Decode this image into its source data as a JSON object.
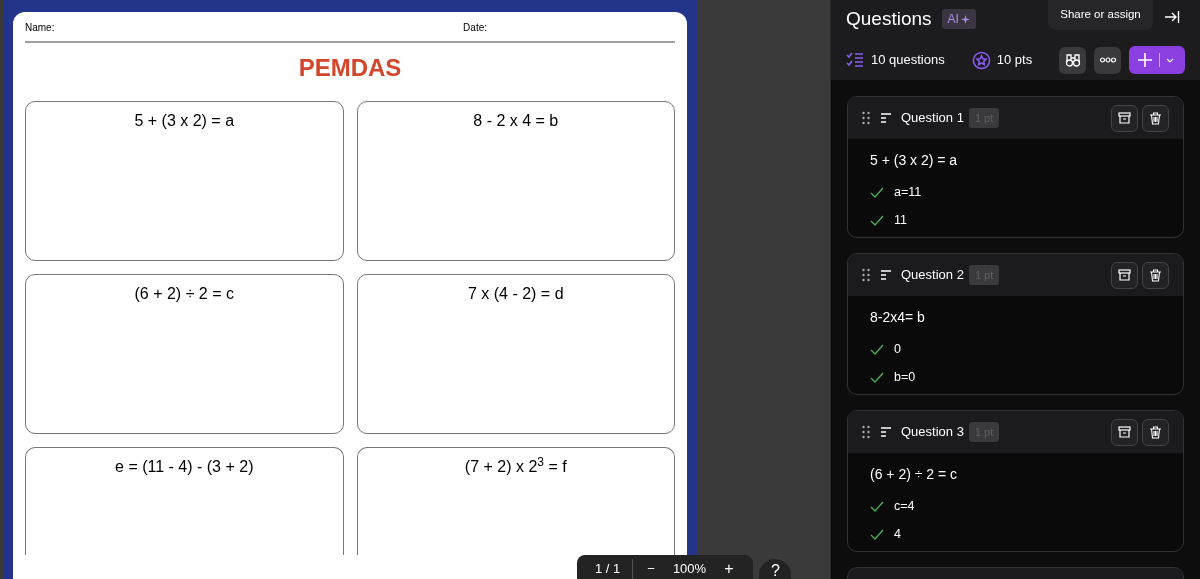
{
  "worksheet": {
    "name_label": "Name:",
    "date_label": "Date:",
    "title": "PEMDAS",
    "problems": [
      "5 + (3 x 2) = a",
      "8 - 2 x 4 = b",
      "(6 + 2) ÷ 2 = c",
      "7 x (4 - 2) = d",
      "e = (11 - 4) - (3 + 2)",
      "(7 + 2) x 2$^{3}$ = f"
    ]
  },
  "viewer_toolbar": {
    "page": "1 / 1",
    "zoom_out": "−",
    "zoom": "100%",
    "zoom_in": "+",
    "help": "?"
  },
  "panel": {
    "title": "Questions",
    "ai_badge": "AI",
    "tooltip": "Share or assign",
    "question_count": "10 questions",
    "points": "10 pts",
    "questions": [
      {
        "title": "Question 1",
        "points": "1 pt",
        "prompt": "5 + (3 x 2) = a",
        "answers": [
          "a=11",
          "11"
        ]
      },
      {
        "title": "Question 2",
        "points": "1 pt",
        "prompt": "8-2x4= b",
        "answers": [
          "0",
          "b=0"
        ]
      },
      {
        "title": "Question 3",
        "points": "1 pt",
        "prompt": "(6 + 2) ÷ 2 = c",
        "answers": [
          "c=4",
          "4"
        ]
      }
    ]
  }
}
